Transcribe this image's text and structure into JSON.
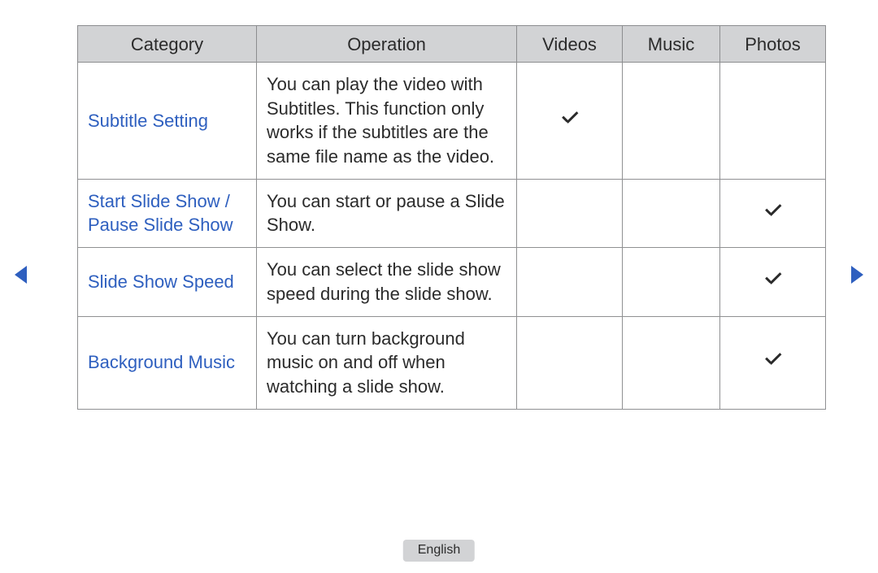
{
  "table": {
    "headers": {
      "category": "Category",
      "operation": "Operation",
      "videos": "Videos",
      "music": "Music",
      "photos": "Photos"
    },
    "rows": [
      {
        "category": "Subtitle Setting",
        "operation": "You can play the video with Subtitles. This function only works if the subtitles are the same file name as the video.",
        "videos": true,
        "music": false,
        "photos": false
      },
      {
        "category": "Start Slide Show / Pause Slide Show",
        "operation": "You can start or pause a Slide Show.",
        "videos": false,
        "music": false,
        "photos": true
      },
      {
        "category": "Slide Show Speed",
        "operation": "You can select the slide show speed during the slide show.",
        "videos": false,
        "music": false,
        "photos": true
      },
      {
        "category": "Background Music",
        "operation": "You can turn background music on and off when watching a slide show.",
        "videos": false,
        "music": false,
        "photos": true
      }
    ]
  },
  "footer": {
    "language": "English"
  },
  "icons": {
    "check": "check-icon",
    "arrow_left": "◀",
    "arrow_right": "▶"
  }
}
